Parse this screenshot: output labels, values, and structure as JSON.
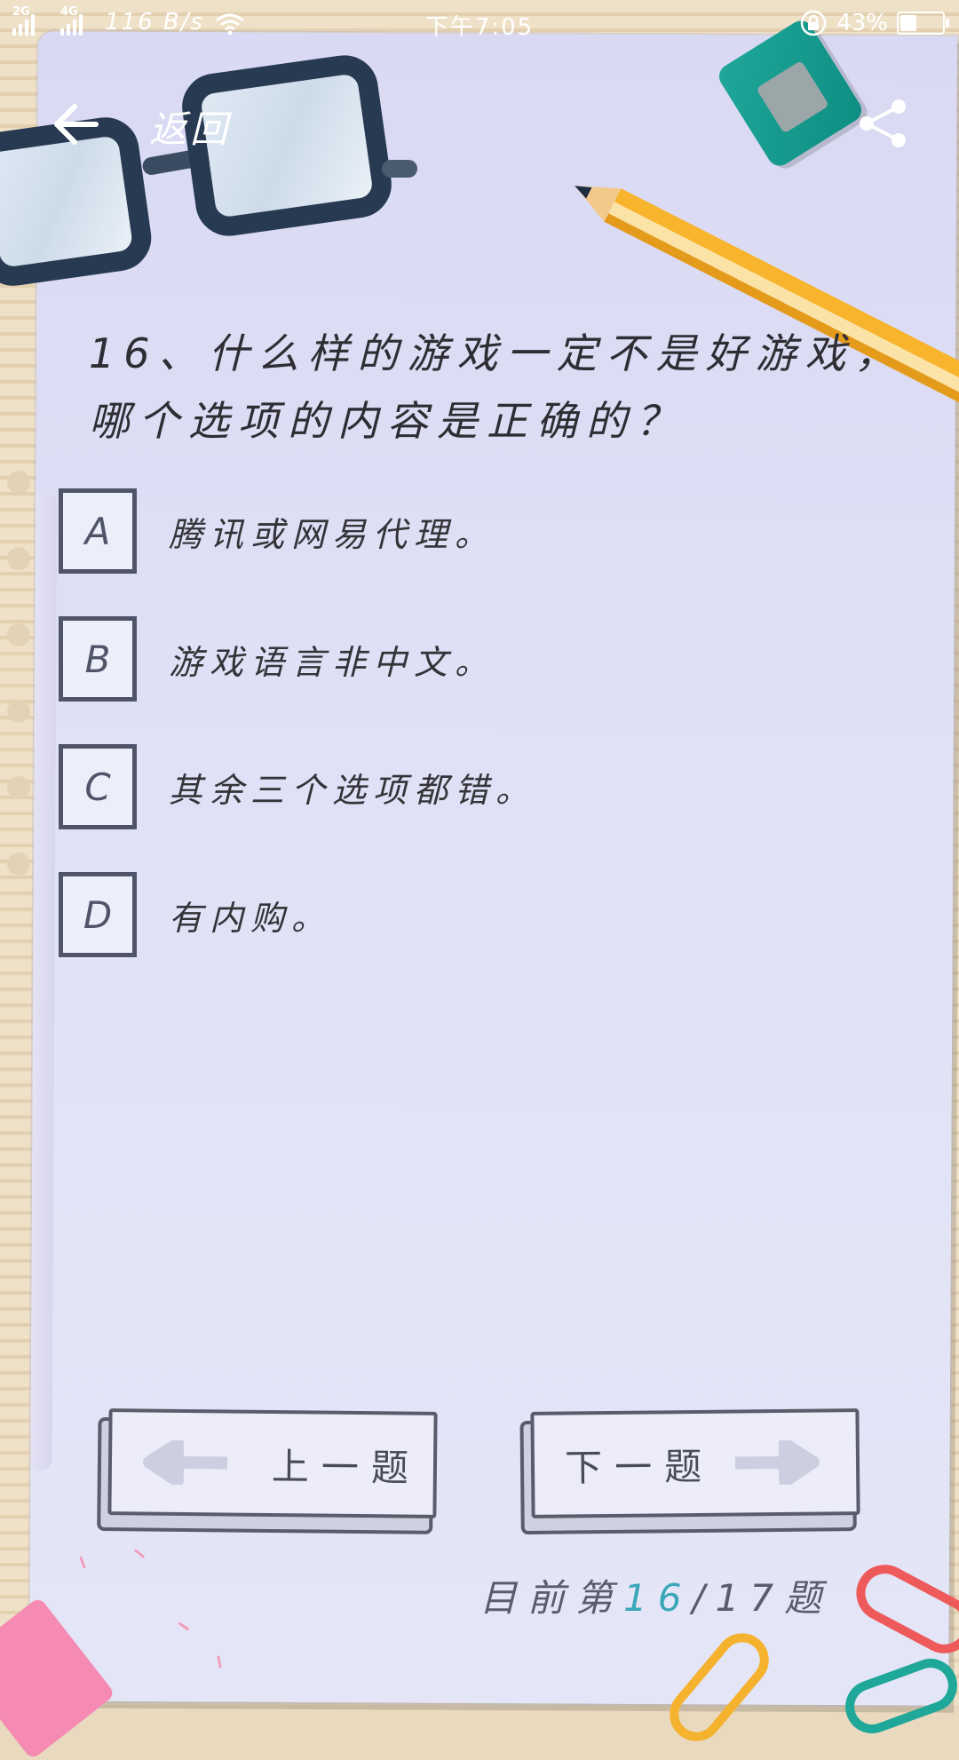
{
  "status_bar": {
    "net1": "2G",
    "net2": "4G",
    "speed": "116 B/s",
    "time": "下午7:05",
    "battery_text": "43%",
    "battery_level": 0.43
  },
  "header": {
    "back_label": "返回"
  },
  "question": {
    "text": "16、什么样的游戏一定不是好游戏，哪个选项的内容是正确的？"
  },
  "options": [
    {
      "letter": "A",
      "text": "腾讯或网易代理。"
    },
    {
      "letter": "B",
      "text": "游戏语言非中文。"
    },
    {
      "letter": "C",
      "text": "其余三个选项都错。"
    },
    {
      "letter": "D",
      "text": "有内购。"
    }
  ],
  "nav": {
    "prev_label": "上一题",
    "next_label": "下一题"
  },
  "progress": {
    "prefix": "目前第",
    "current": "16",
    "separator": "/",
    "total": "17",
    "suffix": "题"
  },
  "colors": {
    "paper": "#e0e1f6",
    "accent": "#3aa7b8",
    "box_border": "#4f5468"
  }
}
